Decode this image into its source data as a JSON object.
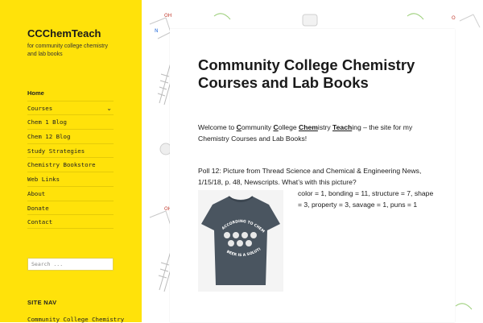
{
  "site": {
    "title": "CCChemTeach",
    "description": "for community college chemistry and lab books"
  },
  "menu": {
    "items": [
      {
        "label": "Home"
      },
      {
        "label": "Courses"
      },
      {
        "label": "Chem 1 Blog"
      },
      {
        "label": "Chem 12 Blog"
      },
      {
        "label": "Study Strategies"
      },
      {
        "label": "Chemistry Bookstore"
      },
      {
        "label": "Web Links"
      },
      {
        "label": "About"
      },
      {
        "label": "Donate"
      },
      {
        "label": "Contact"
      }
    ],
    "submenu_icon": "chevron-down-icon"
  },
  "search": {
    "placeholder": "Search ..."
  },
  "widget": {
    "title": "SITE NAV",
    "link": "Community College Chemistry"
  },
  "post": {
    "title": "Community College Chemistry Courses and Lab Books",
    "intro_prefix": "Welcome to ",
    "intro_c": "C",
    "intro_ommunity": "ommunity ",
    "intro_c2": "C",
    "intro_ollege": "ollege ",
    "intro_chem": "Chem",
    "intro_istry": "istry ",
    "intro_teach": "Teach",
    "intro_suffix": "ing – the site for my Chemistry Courses and Lab Books!",
    "poll": "Poll 12: Picture from Thread Science and Chemical & Engineering News, 1/15/18, p. 48, Newscripts. What’s with this picture?",
    "shirt_text": [
      "ACCORDING TO CHEMISTRY",
      "BEER IS A SOLUTION"
    ],
    "answers": "color = 1, bonding = 11, structure = 7, shape = 3, property = 3, savage = 1, puns = 1"
  },
  "colors": {
    "sidebar": "#ffe20a",
    "shirt": "#4a5560"
  }
}
